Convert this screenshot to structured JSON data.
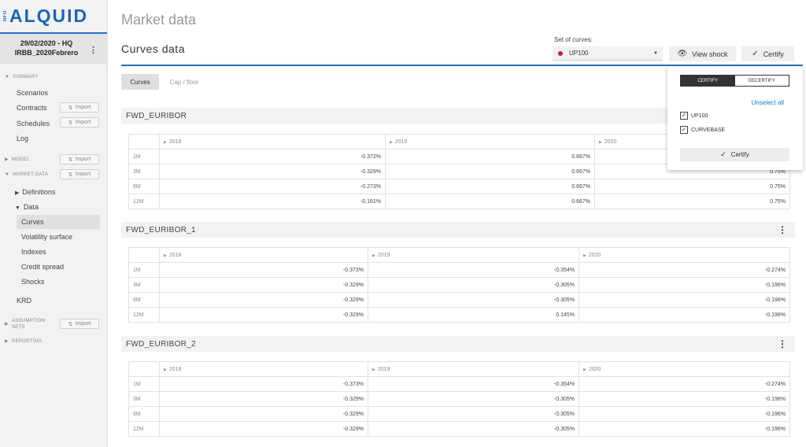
{
  "logo": {
    "nfo": "NFO",
    "text": "ALQUID"
  },
  "session": {
    "date": "29/02/2020 - HQ",
    "scenario": "IRBB_2020Febrero"
  },
  "sidebar": {
    "summary": "SUMMARY",
    "scenarios": "Scenarios",
    "contracts": "Contracts",
    "schedules": "Schedules",
    "log": "Log",
    "model": "MODEL",
    "market_data": "MARKET DATA",
    "definitions": "Definitions",
    "data": "Data",
    "curves": "Curves",
    "volatility": "Volatility surface",
    "indexes": "Indexes",
    "credit_spread": "Credit spread",
    "shocks": "Shocks",
    "krd": "KRD",
    "assumption_sets": "ASSUMPTION SETS",
    "reporting": "REPORTING",
    "import_label": "Import"
  },
  "header": {
    "page_title": "Market data",
    "section_title": "Curves data",
    "set_label": "Set of curves:",
    "set_value": "UP100",
    "view_shock": "View shock",
    "certify": "Certify"
  },
  "tabs": [
    {
      "label": "Curves"
    },
    {
      "label": "Cap / floor"
    }
  ],
  "years": [
    "2018",
    "2019",
    "2020"
  ],
  "curves": [
    {
      "name": "FWD_EURIBOR",
      "rows": [
        {
          "label": "1M",
          "values": [
            "-0.372%",
            "0.667%",
            "0.75%"
          ]
        },
        {
          "label": "3M",
          "values": [
            "-0.329%",
            "0.667%",
            "0.75%"
          ]
        },
        {
          "label": "6M",
          "values": [
            "-0.273%",
            "0.667%",
            "0.75%"
          ]
        },
        {
          "label": "12M",
          "values": [
            "-0.161%",
            "0.667%",
            "0.75%"
          ]
        }
      ]
    },
    {
      "name": "FWD_EURIBOR_1",
      "rows": [
        {
          "label": "1M",
          "values": [
            "-0.373%",
            "-0.354%",
            "-0.274%"
          ]
        },
        {
          "label": "3M",
          "values": [
            "-0.329%",
            "-0.305%",
            "-0.196%"
          ]
        },
        {
          "label": "6M",
          "values": [
            "-0.329%",
            "-0.305%",
            "-0.196%"
          ]
        },
        {
          "label": "12M",
          "values": [
            "-0.329%",
            "0.145%",
            "-0.196%"
          ]
        }
      ]
    },
    {
      "name": "FWD_EURIBOR_2",
      "rows": [
        {
          "label": "1M",
          "values": [
            "-0.373%",
            "-0.354%",
            "-0.274%"
          ]
        },
        {
          "label": "3M",
          "values": [
            "-0.329%",
            "-0.305%",
            "-0.196%"
          ]
        },
        {
          "label": "6M",
          "values": [
            "-0.329%",
            "-0.305%",
            "-0.196%"
          ]
        },
        {
          "label": "12M",
          "values": [
            "-0.329%",
            "-0.305%",
            "-0.196%"
          ]
        }
      ]
    }
  ],
  "popup": {
    "certify_tab": "CERTIFY",
    "decertify_tab": "DECERTIFY",
    "unselect_all": "Unselect all",
    "options": [
      {
        "label": "UP100",
        "checked": true
      },
      {
        "label": "CURVEBASE",
        "checked": true
      }
    ],
    "certify_button": "Certify"
  },
  "colors": {
    "accent": "#1976d2",
    "set_dot": "#c2185b"
  }
}
